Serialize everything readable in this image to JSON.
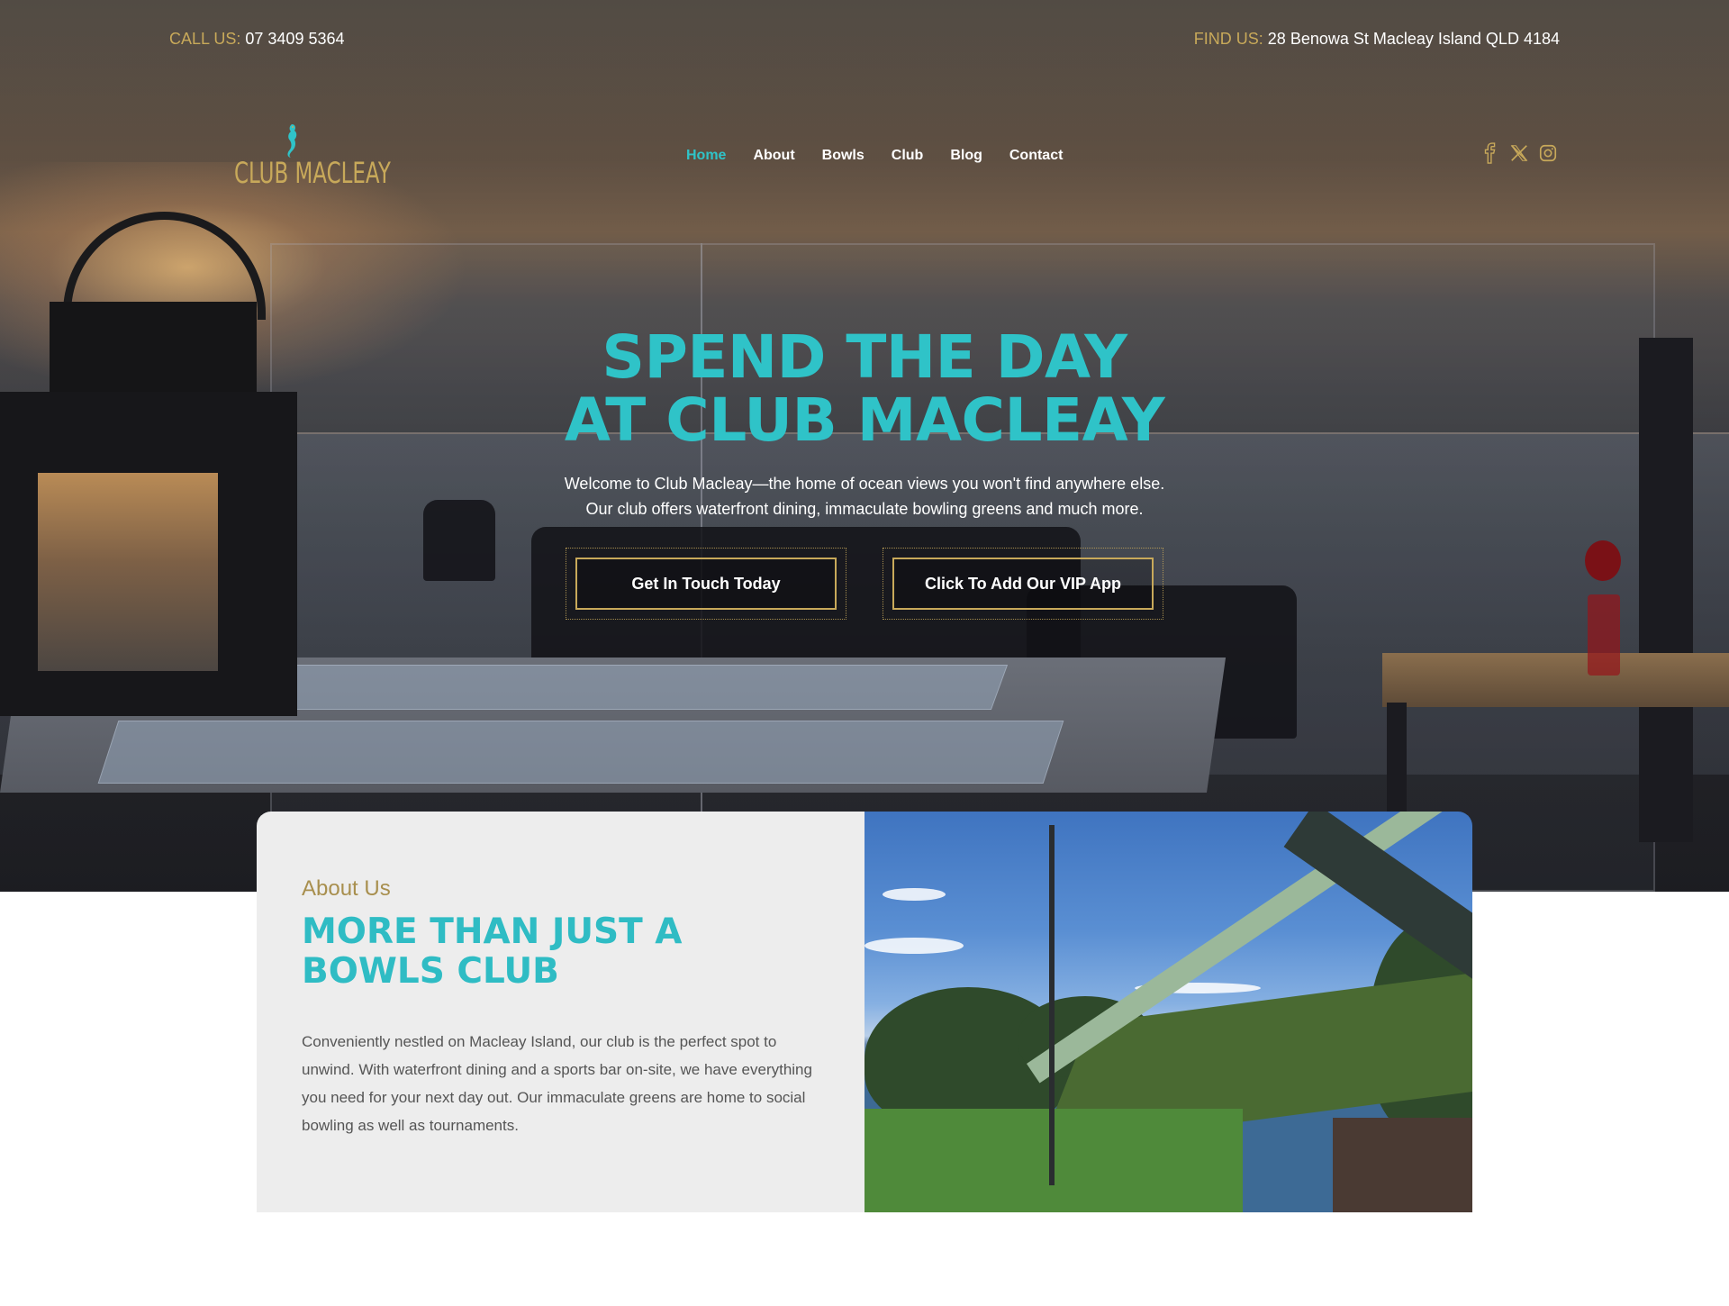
{
  "topbar": {
    "call_label": "CALL US:",
    "call_value": "07 3409 5364",
    "find_label": "FIND US:",
    "find_value": "28 Benowa St Macleay Island QLD 4184"
  },
  "logo": {
    "text": "CLUB MACLEAY"
  },
  "nav": {
    "items": [
      {
        "label": "Home",
        "active": true
      },
      {
        "label": "About"
      },
      {
        "label": "Bowls"
      },
      {
        "label": "Club"
      },
      {
        "label": "Blog"
      },
      {
        "label": "Contact"
      }
    ]
  },
  "social": [
    "facebook-icon",
    "x-twitter-icon",
    "instagram-icon"
  ],
  "hero": {
    "title_line1": "SPEND THE DAY",
    "title_line2": "AT CLUB MACLEAY",
    "subtitle_line1": "Welcome to Club Macleay—the home of ocean views you won't find anywhere else.",
    "subtitle_line2": "Our club offers waterfront dining, immaculate bowling greens and much more.",
    "button_primary": "Get In Touch Today",
    "button_secondary": "Click To Add Our VIP App"
  },
  "about": {
    "eyebrow": "About Us",
    "title_line1": "MORE THAN JUST A",
    "title_line2": "BOWLS CLUB",
    "body": "Conveniently nestled on Macleay Island, our club is the perfect spot to unwind. With waterfront dining and a sports bar on-site, we have everything you need for your next day out. Our immaculate greens are home to social bowling as well as tournaments."
  },
  "colors": {
    "accent_teal": "#2fc3c8",
    "accent_gold": "#c8a95a",
    "card_bg": "#ededed"
  }
}
